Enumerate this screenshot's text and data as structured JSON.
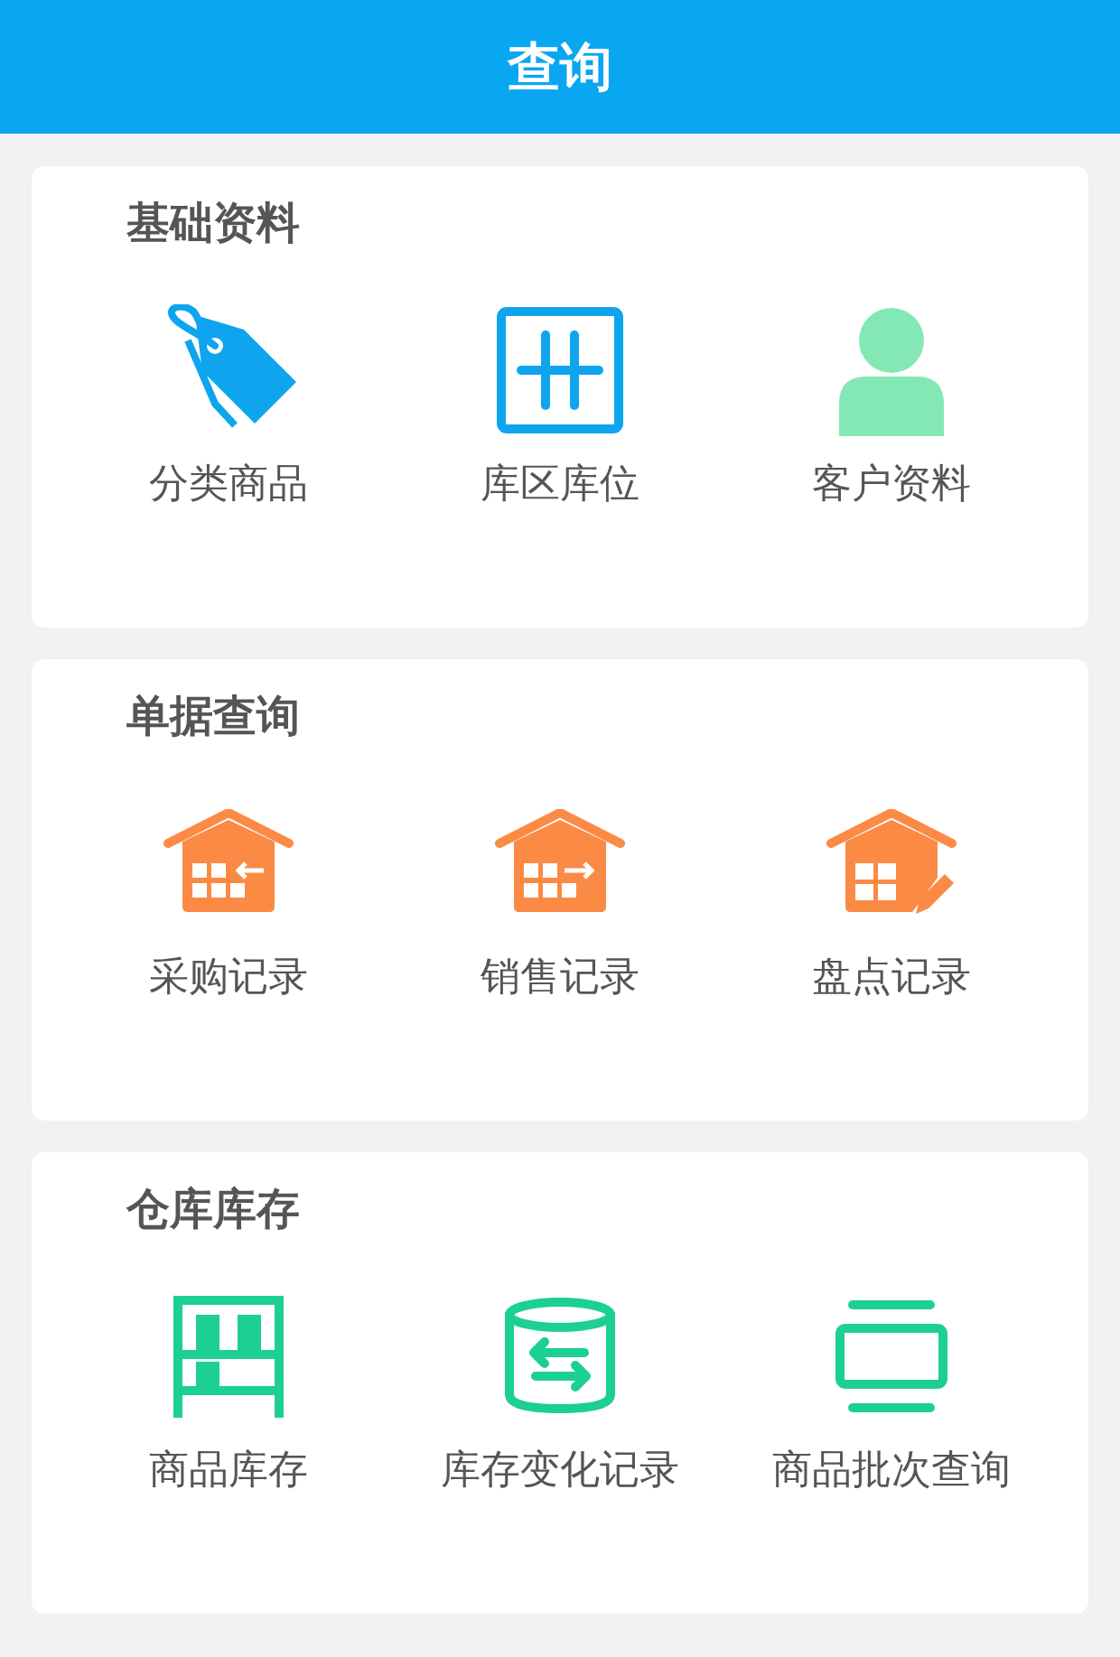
{
  "header": {
    "title": "查询"
  },
  "sections": [
    {
      "title": "基础资料",
      "items": [
        {
          "label": "分类商品"
        },
        {
          "label": "库区库位"
        },
        {
          "label": "客户资料"
        }
      ]
    },
    {
      "title": "单据查询",
      "items": [
        {
          "label": "采购记录"
        },
        {
          "label": "销售记录"
        },
        {
          "label": "盘点记录"
        }
      ]
    },
    {
      "title": "仓库库存",
      "items": [
        {
          "label": "商品库存"
        },
        {
          "label": "库存变化记录"
        },
        {
          "label": "商品批次查询"
        }
      ]
    }
  ]
}
